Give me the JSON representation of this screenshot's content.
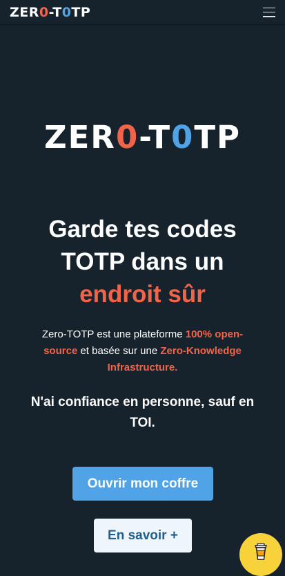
{
  "navbar": {
    "brand_prefix": "ZER",
    "brand_zero": "0",
    "brand_middle": "-T",
    "brand_o": "0",
    "brand_suffix": "TP",
    "menu_icon": "hamburger-menu-icon"
  },
  "hero": {
    "logo_prefix": "ZER",
    "logo_zero": "0",
    "logo_middle": "-T",
    "logo_o": "0",
    "logo_suffix": "TP",
    "headline_line1": "Garde tes codes",
    "headline_line2": "TOTP dans un",
    "headline_accent": "endroit sûr",
    "desc_part1": "Zero-TOTP est une plateforme ",
    "desc_hl1": "100% open-source",
    "desc_part2": " et basée sur une ",
    "desc_hl2": "Zero-Knowledge Infrastructure.",
    "tagline": "N'ai confiance en personne, sauf en TOI.",
    "primary_button": "Ouvrir mon coffre",
    "secondary_button": "En savoir +"
  },
  "floating": {
    "coffee_icon": "coffee-cup-icon"
  },
  "colors": {
    "background": "#16232d",
    "accent_red": "#f26449",
    "accent_blue": "#4fa3e6",
    "button_light": "#eef6fc",
    "button_light_text": "#225f8c",
    "coffee_yellow": "#f7d23a"
  }
}
